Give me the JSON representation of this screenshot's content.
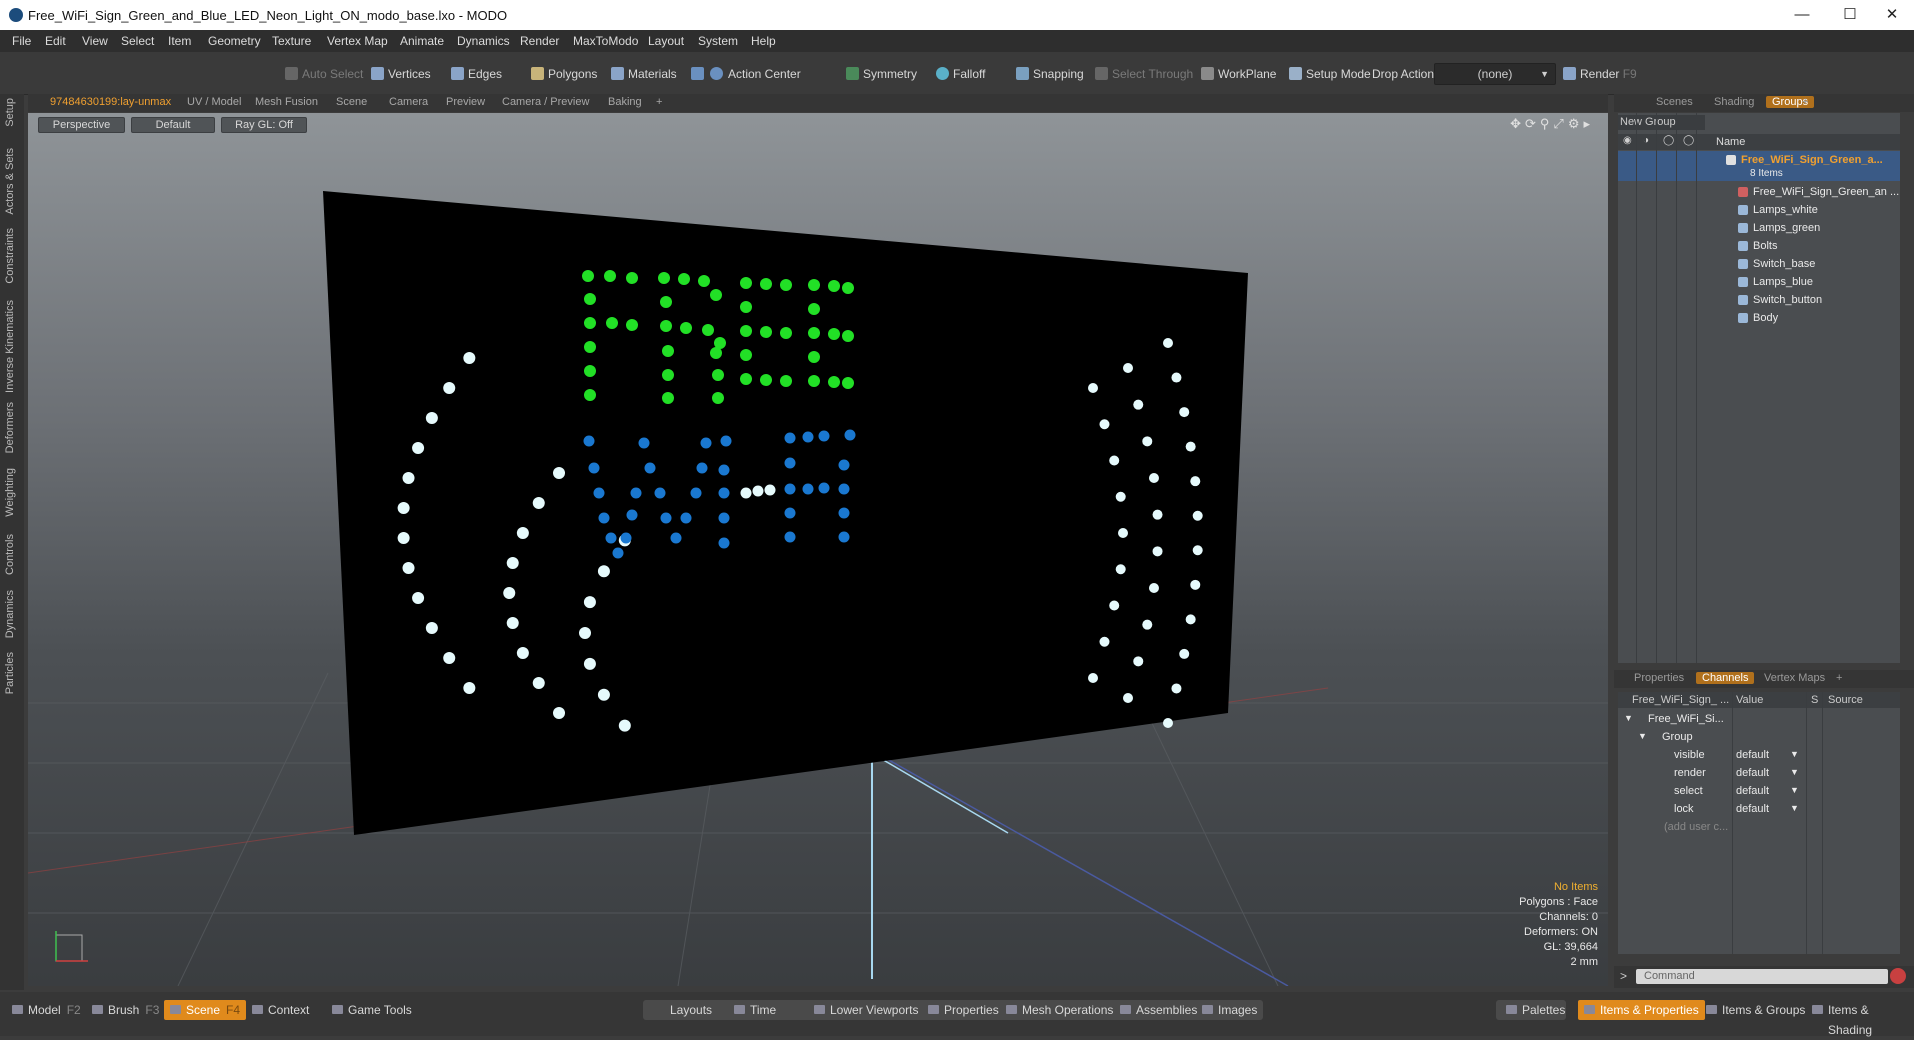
{
  "window": {
    "title": "Free_WiFi_Sign_Green_and_Blue_LED_Neon_Light_ON_modo_base.lxo - MODO"
  },
  "menubar": [
    "File",
    "Edit",
    "View",
    "Select",
    "Item",
    "Geometry",
    "Texture",
    "Vertex Map",
    "Animate",
    "Dynamics",
    "Render",
    "MaxToModo",
    "Layout",
    "System",
    "Help"
  ],
  "toolbar": {
    "auto_select": "Auto Select",
    "vertices": "Vertices",
    "edges": "Edges",
    "polygons": "Polygons",
    "materials": "Materials",
    "action_center": "Action Center",
    "symmetry": "Symmetry",
    "falloff": "Falloff",
    "snapping": "Snapping",
    "select_through": "Select Through",
    "workplane": "WorkPlane",
    "setup_mode": "Setup Mode",
    "drop_action": "Drop Action",
    "drop_value": "(none)",
    "render": "Render",
    "render_key": "F9"
  },
  "left_tabs": [
    "Setup",
    "Actors & Sets",
    "Constraints",
    "Inverse Kinematics",
    "Deformers",
    "Weighting",
    "Controls",
    "Dynamics",
    "Particles"
  ],
  "viewport_tabs": [
    "97484630199:lay-unmax",
    "UV / Model",
    "Mesh Fusion",
    "Scene",
    "Camera",
    "Preview",
    "Camera / Preview",
    "Baking",
    "+"
  ],
  "viewport": {
    "view_mode": "Perspective",
    "shading": "Default",
    "raygl": "Ray GL: Off",
    "info": {
      "items": "No Items",
      "polygons": "Polygons : Face",
      "channels": "Channels: 0",
      "deformers": "Deformers: ON",
      "gl": "GL: 39,664",
      "scale": "2 mm"
    }
  },
  "right_tabs_top": [
    "Scenes",
    "Shading",
    "Groups",
    "+"
  ],
  "groups": {
    "new_group": "New Group",
    "col_name": "Name",
    "root_name": "Free_WiFi_Sign_Green_a...",
    "root_count": "8 Items",
    "items": [
      "Free_WiFi_Sign_Green_an ...",
      "Lamps_white",
      "Lamps_green",
      "Bolts",
      "Switch_base",
      "Lamps_blue",
      "Switch_button",
      "Body"
    ]
  },
  "right_tabs_bottom": [
    "Properties",
    "Channels",
    "Vertex Maps",
    "+"
  ],
  "channels": {
    "col_name": "Free_WiFi_Sign_ ...",
    "col_value": "Value",
    "col_s": "S",
    "col_source": "Source",
    "root": "Free_WiFi_Si...",
    "group": "Group",
    "rows": [
      {
        "key": "visible",
        "value": "default"
      },
      {
        "key": "render",
        "value": "default"
      },
      {
        "key": "select",
        "value": "default"
      },
      {
        "key": "lock",
        "value": "default"
      }
    ],
    "add_user": "(add user c..."
  },
  "command": {
    "placeholder": "Command"
  },
  "bottombar": {
    "model": "Model",
    "model_key": "F2",
    "brush": "Brush",
    "brush_key": "F3",
    "scene": "Scene",
    "scene_key": "F4",
    "context": "Context",
    "game_tools": "Game Tools",
    "layouts": "Layouts",
    "time": "Time",
    "lower_viewports": "Lower Viewports",
    "properties": "Properties",
    "mesh_operations": "Mesh Operations",
    "assemblies": "Assemblies",
    "images": "Images",
    "palettes": "Palettes",
    "items_properties": "Items & Properties",
    "items_groups": "Items & Groups",
    "items_shading": "Items & Shading"
  },
  "colors": {
    "accent": "#e08a1c",
    "green_led": "#22e026",
    "blue_led": "#1a78d0",
    "white_led": "#e6fafc"
  }
}
